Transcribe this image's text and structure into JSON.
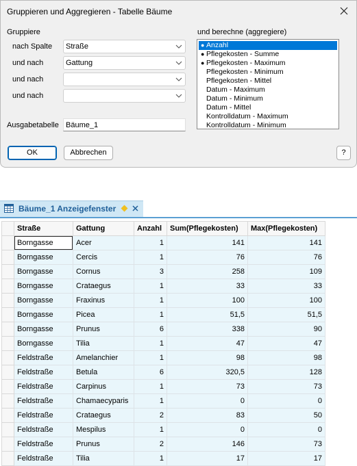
{
  "dialog": {
    "title": "Gruppieren und Aggregieren - Tabelle Bäume",
    "group_heading": "Gruppiere",
    "aggregate_heading": "und berechne (aggregiere)",
    "rows": [
      {
        "label": "nach Spalte",
        "value": ""
      },
      {
        "label": "und nach",
        "value": ""
      },
      {
        "label": "und nach",
        "value": ""
      },
      {
        "label": "und nach",
        "value": ""
      }
    ],
    "row_values": [
      "Straße",
      "Gattung",
      "",
      ""
    ],
    "output_label": "Ausgabetabelle",
    "output_value": "Bäume_1",
    "aggregations": [
      {
        "label": "Anzahl",
        "checked": true,
        "selected": true
      },
      {
        "label": "Pflegekosten - Summe",
        "checked": true,
        "selected": false
      },
      {
        "label": "Pflegekosten - Maximum",
        "checked": true,
        "selected": false
      },
      {
        "label": "Pflegekosten - Minimum",
        "checked": false,
        "selected": false
      },
      {
        "label": "Pflegekosten - Mittel",
        "checked": false,
        "selected": false
      },
      {
        "label": "Datum - Maximum",
        "checked": false,
        "selected": false
      },
      {
        "label": "Datum - Minimum",
        "checked": false,
        "selected": false
      },
      {
        "label": "Datum - Mittel",
        "checked": false,
        "selected": false
      },
      {
        "label": "Kontrolldatum - Maximum",
        "checked": false,
        "selected": false
      },
      {
        "label": "Kontrolldatum - Minimum",
        "checked": false,
        "selected": false
      }
    ],
    "ok_label": "OK",
    "cancel_label": "Abbrechen",
    "help_label": "?",
    "accent_color": "#0078d7"
  },
  "window": {
    "title": "Bäume_1 Anzeigefenster",
    "tab_color": "#cfe7f5",
    "pin_color": "#f0c020",
    "close_color": "#1f5f99"
  },
  "table": {
    "columns": [
      "Straße",
      "Gattung",
      "Anzahl",
      "Sum(Pflegekosten)",
      "Max(Pflegekosten)"
    ],
    "rows": [
      [
        "Borngasse",
        "Acer",
        "1",
        "141",
        "141"
      ],
      [
        "Borngasse",
        "Cercis",
        "1",
        "76",
        "76"
      ],
      [
        "Borngasse",
        "Cornus",
        "3",
        "258",
        "109"
      ],
      [
        "Borngasse",
        "Crataegus",
        "1",
        "33",
        "33"
      ],
      [
        "Borngasse",
        "Fraxinus",
        "1",
        "100",
        "100"
      ],
      [
        "Borngasse",
        "Picea",
        "1",
        "51,5",
        "51,5"
      ],
      [
        "Borngasse",
        "Prunus",
        "6",
        "338",
        "90"
      ],
      [
        "Borngasse",
        "Tilia",
        "1",
        "47",
        "47"
      ],
      [
        "Feldstraße",
        "Amelanchier",
        "1",
        "98",
        "98"
      ],
      [
        "Feldstraße",
        "Betula",
        "6",
        "320,5",
        "128"
      ],
      [
        "Feldstraße",
        "Carpinus",
        "1",
        "73",
        "73"
      ],
      [
        "Feldstraße",
        "Chamaecyparis",
        "1",
        "0",
        "0"
      ],
      [
        "Feldstraße",
        "Crataegus",
        "2",
        "83",
        "50"
      ],
      [
        "Feldstraße",
        "Mespilus",
        "1",
        "0",
        "0"
      ],
      [
        "Feldstraße",
        "Prunus",
        "2",
        "146",
        "73"
      ],
      [
        "Feldstraße",
        "Tilia",
        "1",
        "17",
        "17"
      ]
    ]
  }
}
